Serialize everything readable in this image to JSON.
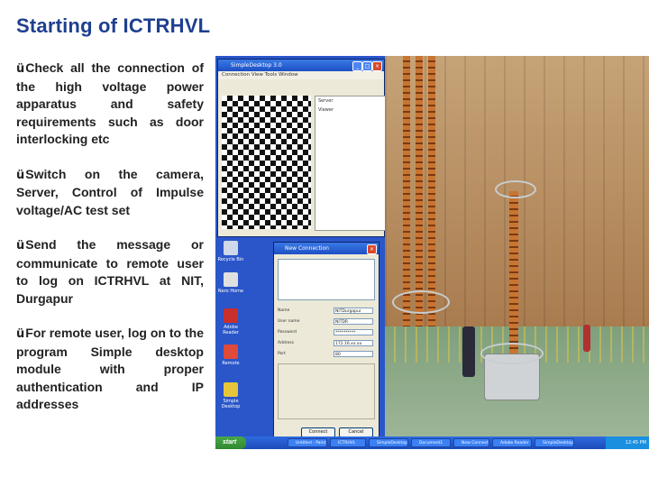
{
  "title": "Starting of ICTRHVL",
  "bullets": [
    {
      "check": "ü",
      "text": "Check all the connection of the high voltage power apparatus and safety requirements such as door interlocking etc"
    },
    {
      "check": "ü",
      "text": "Switch on the camera, Server, Control of Impulse voltage/AC test set"
    },
    {
      "check": "ü",
      "text": "Send the message or communicate to remote user to log on ICTRHVL at NIT, Durgapur"
    },
    {
      "check": "ü",
      "text": "For remote user, log on to the program Simple desktop module with proper authentication and IP addresses"
    }
  ],
  "screenshot": {
    "window_title": "SimpleDesktop 3.0",
    "menu": "Connection  View  Tools  Window",
    "side_items": [
      "Server",
      "Viewer"
    ],
    "desktop_icons": [
      "Recycle Bin",
      "Nero Home",
      "Adobe Reader",
      "Remote",
      "Simple Desktop"
    ],
    "dialog": {
      "title": "New Connection",
      "fields": [
        {
          "label": "Name",
          "value": "NITDurgapur"
        },
        {
          "label": "User name",
          "value": "NITDR"
        },
        {
          "label": "Password",
          "value": "**********"
        },
        {
          "label": "Address",
          "value": "172.16.xx.xx"
        },
        {
          "label": "Port",
          "value": "80"
        }
      ],
      "connect_label": "Connect",
      "cancel_label": "Cancel"
    },
    "taskbar": {
      "start_label": "start",
      "items": [
        "Untitled - Paint",
        "ICTRHVL",
        "SimpleDesktop",
        "Document1",
        "New Connection",
        "Adobe Reader",
        "SimpleDesktop 3"
      ],
      "clock": "12:45 PM"
    }
  },
  "photo": {
    "subject": "high voltage laboratory"
  }
}
